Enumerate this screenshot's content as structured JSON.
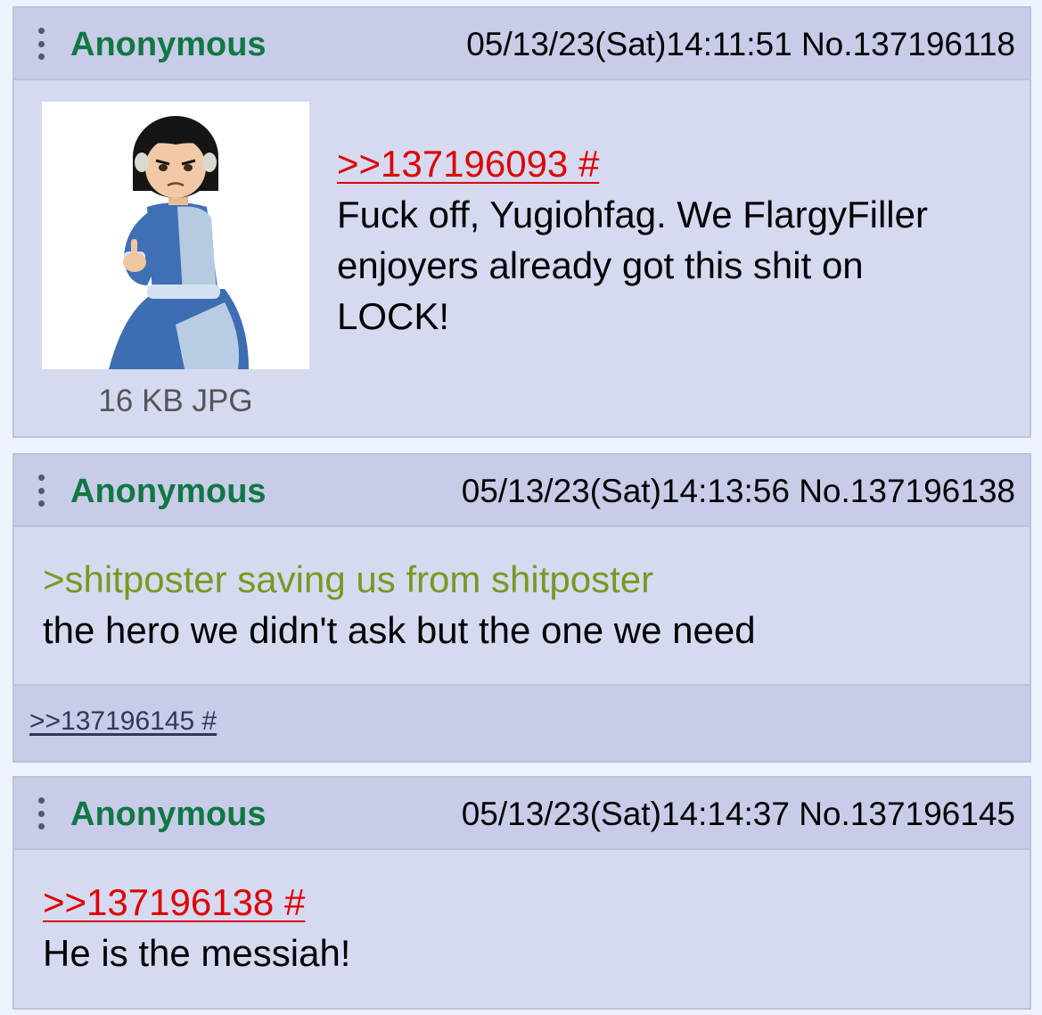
{
  "posts": [
    {
      "author": "Anonymous",
      "meta": "05/13/23(Sat)14:11:51 No.137196118",
      "quote_link": ">>137196093 #",
      "body_lines": [
        "Fuck off, Yugiohfag. We FlargyFiller",
        "enjoyers already got this shit on",
        "LOCK!"
      ],
      "file_info": "16 KB JPG",
      "thumbnail_icon": "cartoon-girl-middle-finger-thumbnail"
    },
    {
      "author": "Anonymous",
      "meta": "05/13/23(Sat)14:13:56 No.137196138",
      "greentext": ">shitposter saving us from shitposter",
      "body": "the hero we didn't ask but the one we need",
      "reply_link": ">>137196145 #"
    },
    {
      "author": "Anonymous",
      "meta": "05/13/23(Sat)14:14:37 No.137196145",
      "quote_link": ">>137196138 #",
      "body": "He is the messiah!"
    }
  ],
  "colors": {
    "author": "#117743",
    "quotelink": "#dd0000",
    "greentext": "#789922",
    "post_bg": "#d6daf0",
    "header_bg": "#c8cce8"
  },
  "icons": {
    "menu": "vertical-dots-menu-icon"
  }
}
